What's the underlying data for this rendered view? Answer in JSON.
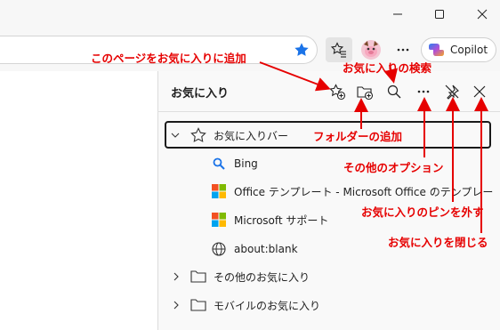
{
  "toolbar": {
    "copilot_label": "Copilot"
  },
  "panel": {
    "title": "お気に入り",
    "items": [
      {
        "label": "お気に入りバー",
        "icon": "star-outline-icon"
      },
      {
        "label": "Bing",
        "icon": "bing-search-icon"
      },
      {
        "label": "Office テンプレート - Microsoft Office のテンプレー",
        "icon": "microsoft-logo-icon"
      },
      {
        "label": "Microsoft サポート",
        "icon": "microsoft-logo-icon"
      },
      {
        "label": "about:blank",
        "icon": "globe-icon"
      },
      {
        "label": "その他のお気に入り",
        "icon": "folder-icon"
      },
      {
        "label": "モバイルのお気に入り",
        "icon": "folder-icon"
      }
    ]
  },
  "annotations": {
    "add_current": "このページをお気に入りに追加",
    "search": "お気に入りの検索",
    "add_folder": "フォルダーの追加",
    "more_options": "その他のオプション",
    "unpin": "お気に入りのピンを外す",
    "close": "お気に入りを閉じる"
  },
  "colors": {
    "annotation": "#e60000",
    "favorite_star": "#1a73e8",
    "microsoft_red": "#f25022",
    "microsoft_green": "#7fba00",
    "microsoft_blue": "#00a4ef",
    "microsoft_yellow": "#ffb900"
  }
}
